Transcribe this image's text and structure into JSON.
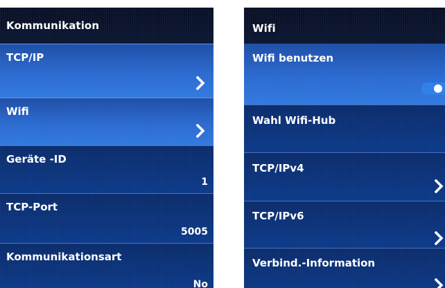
{
  "left_screen": {
    "title": "Kommunikation",
    "items": [
      {
        "label": "TCP/IP",
        "value": "",
        "has_chevron": true,
        "selected": true
      },
      {
        "label": "Wifi",
        "value": "",
        "has_chevron": true,
        "selected": true
      },
      {
        "label": "Geräte -ID",
        "value": "1",
        "has_chevron": false,
        "selected": false
      },
      {
        "label": "TCP-Port",
        "value": "5005",
        "has_chevron": false,
        "selected": false
      },
      {
        "label": "Kommunikationsart",
        "value": "No",
        "has_chevron": false,
        "selected": false
      }
    ]
  },
  "right_screen": {
    "title": "Wifi",
    "items": [
      {
        "label": "Wifi benutzen",
        "control": "toggle",
        "toggle_on": true,
        "selected": true
      },
      {
        "label": "Wahl Wifi-Hub",
        "control": "none",
        "selected": false
      },
      {
        "label": "TCP/IPv4",
        "control": "chevron",
        "selected": false
      },
      {
        "label": "TCP/IPv6",
        "control": "chevron",
        "selected": false
      },
      {
        "label": "Verbind.-Information",
        "control": "chevron",
        "selected": false
      }
    ]
  },
  "colors": {
    "screen_bg": "#0b2c6b",
    "selected_bg": "#2b6ad0",
    "text": "#ffffff",
    "toggle_on": "#2f7fe8"
  },
  "icons": {
    "chevron": "chevron-right-icon"
  }
}
